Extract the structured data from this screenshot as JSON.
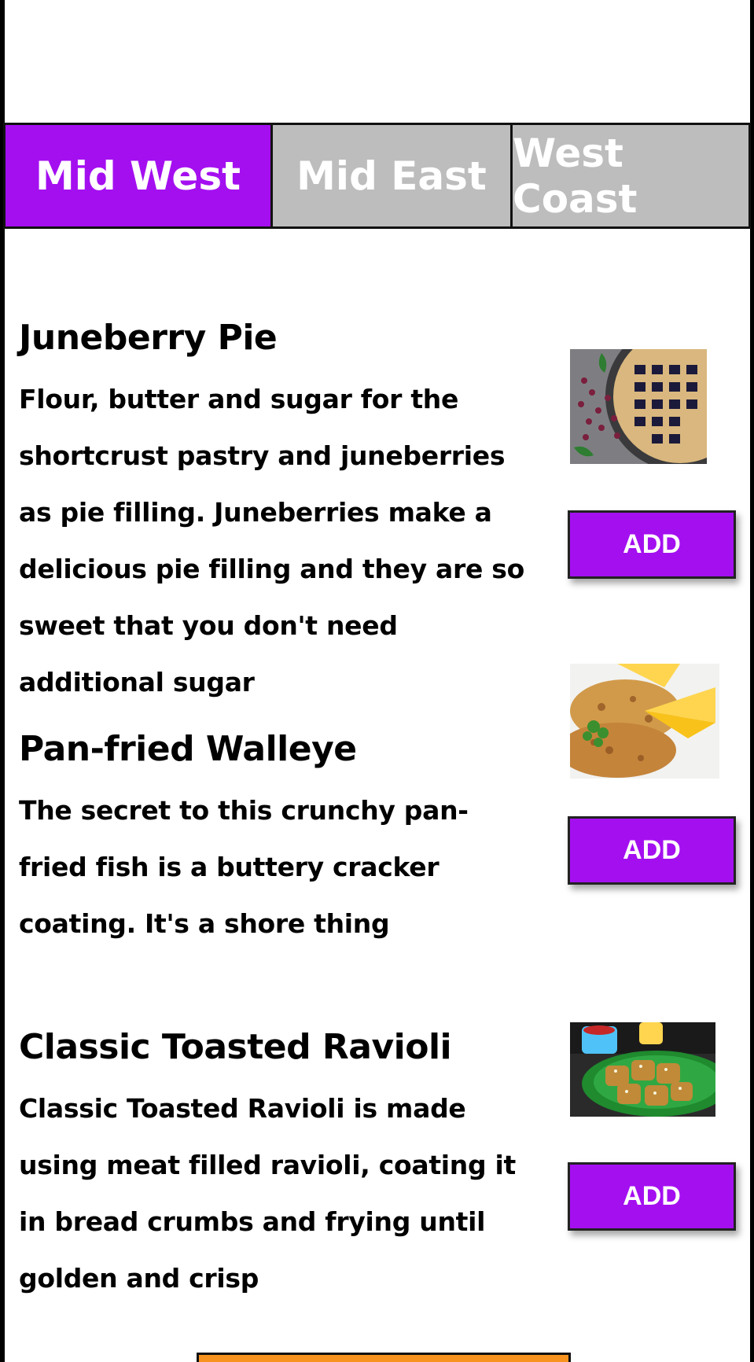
{
  "tabs": [
    {
      "label": "Mid West",
      "active": true
    },
    {
      "label": "Mid East",
      "active": false
    },
    {
      "label": "West Coast",
      "active": false
    }
  ],
  "items": [
    {
      "title": "Juneberry Pie",
      "description": "Flour, butter and sugar for the shortcrust pastry and juneberries as pie filling. Juneberries make a delicious pie filling and they are so sweet that you don't need additional sugar",
      "image": "juneberry-pie-photo",
      "add_label": "ADD"
    },
    {
      "title": "Pan-fried Walleye",
      "description": "The secret to this crunchy pan-fried fish is a buttery cracker coating. It's a shore thing",
      "image": "pan-fried-walleye-photo",
      "add_label": "ADD"
    },
    {
      "title": "Classic Toasted Ravioli",
      "description": "Classic Toasted Ravioli is made using meat filled ravioli, coating it in bread crumbs and frying until golden and crisp",
      "image": "toasted-ravioli-photo",
      "add_label": "ADD"
    }
  ],
  "colors": {
    "accent": "#a40ff0",
    "tab_inactive": "#bdbdbd",
    "bottom_button": "#f7931e"
  }
}
